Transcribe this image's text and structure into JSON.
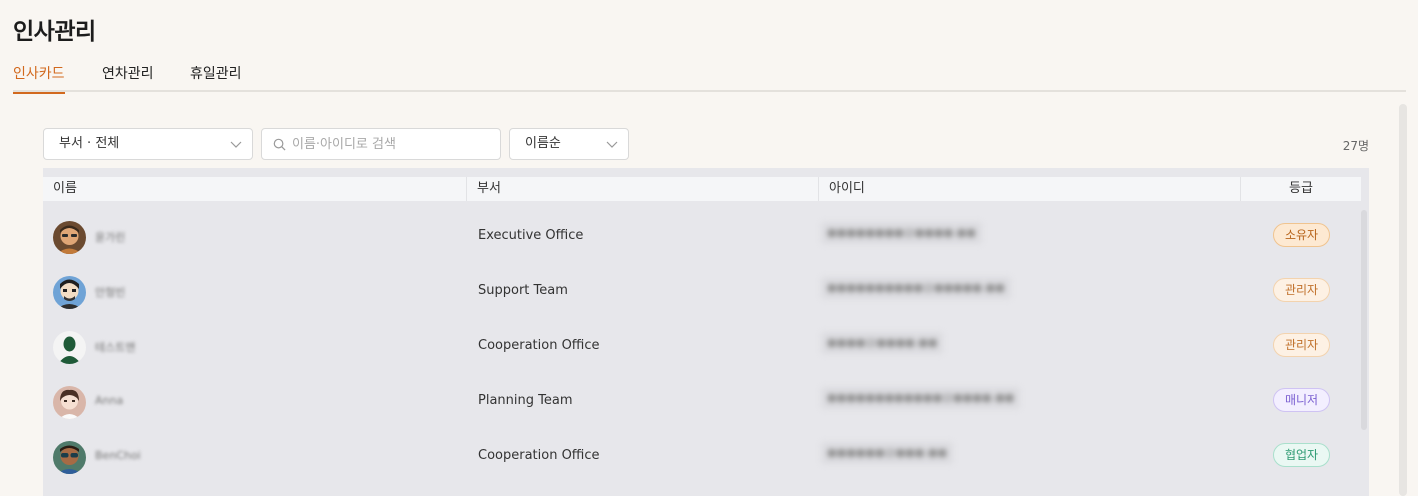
{
  "page_title": "인사관리",
  "tabs": [
    {
      "label": "인사카드",
      "active": true
    },
    {
      "label": "연차관리",
      "active": false
    },
    {
      "label": "휴일관리",
      "active": false
    }
  ],
  "filters": {
    "department": "부서 · 전체",
    "search_placeholder": "이름·아이디로 검색",
    "sort": "이름순"
  },
  "count": "27명",
  "table": {
    "columns": [
      "이름",
      "부서",
      "아이디",
      "등급"
    ],
    "rows": [
      {
        "name": "윤가린",
        "department": "Executive Office",
        "id": "●●●●●●●●@●●●●.●●",
        "grade": "소유자",
        "grade_style": "owner"
      },
      {
        "name": "안형빈",
        "department": "Support Team",
        "id": "●●●●●●●●●●@●●●●●.●●",
        "grade": "관리자",
        "grade_style": "admin"
      },
      {
        "name": "테스트맨",
        "department": "Cooperation Office",
        "id": "●●●●@●●●●.●●",
        "grade": "관리자",
        "grade_style": "admin"
      },
      {
        "name": "Anna",
        "department": "Planning Team",
        "id": "●●●●●●●●●●●●@●●●●.●●",
        "grade": "매니저",
        "grade_style": "manager"
      },
      {
        "name": "BenChoi",
        "department": "Cooperation Office",
        "id": "●●●●●●@●●●.●●",
        "grade": "협업자",
        "grade_style": "collaborator"
      }
    ]
  },
  "colors": {
    "accent": "#d2691e",
    "owner_bg": "#fde9d2",
    "owner_border": "#f0c48f",
    "owner_text": "#b8651c",
    "admin_bg": "#fdf1e4",
    "admin_border": "#f3d3ae",
    "admin_text": "#c0702a",
    "manager_bg": "#f3efff",
    "manager_border": "#cfc3f3",
    "manager_text": "#7a5fd1",
    "collaborator_bg": "#eaf8f3",
    "collaborator_border": "#a9e0cc",
    "collaborator_text": "#2c9a72"
  }
}
